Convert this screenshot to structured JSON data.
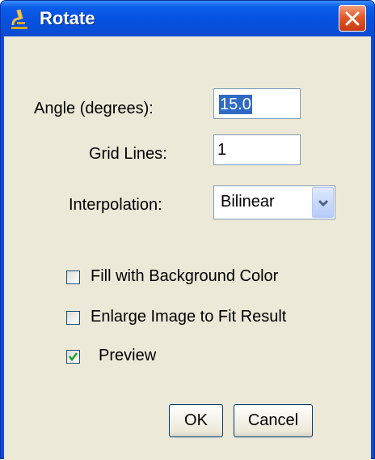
{
  "dialog": {
    "title": "Rotate",
    "app_icon": "microscope-icon",
    "close_icon": "close-icon"
  },
  "fields": {
    "angle": {
      "label": "Angle (degrees):",
      "value": "15.0"
    },
    "grid_lines": {
      "label": "Grid Lines:",
      "value": "1"
    },
    "interpolation": {
      "label": "Interpolation:",
      "selected": "Bilinear"
    }
  },
  "options": {
    "fill_background": {
      "label": "Fill with Background Color",
      "checked": false
    },
    "enlarge_image": {
      "label": "Enlarge Image to Fit Result",
      "checked": false
    },
    "preview": {
      "label": "Preview",
      "checked": true
    }
  },
  "buttons": {
    "ok": "OK",
    "cancel": "Cancel"
  },
  "colors": {
    "title_bar": "#0551e0",
    "client": "#ece9d8",
    "close_button": "#e25a2a",
    "selection": "#316ac5"
  }
}
